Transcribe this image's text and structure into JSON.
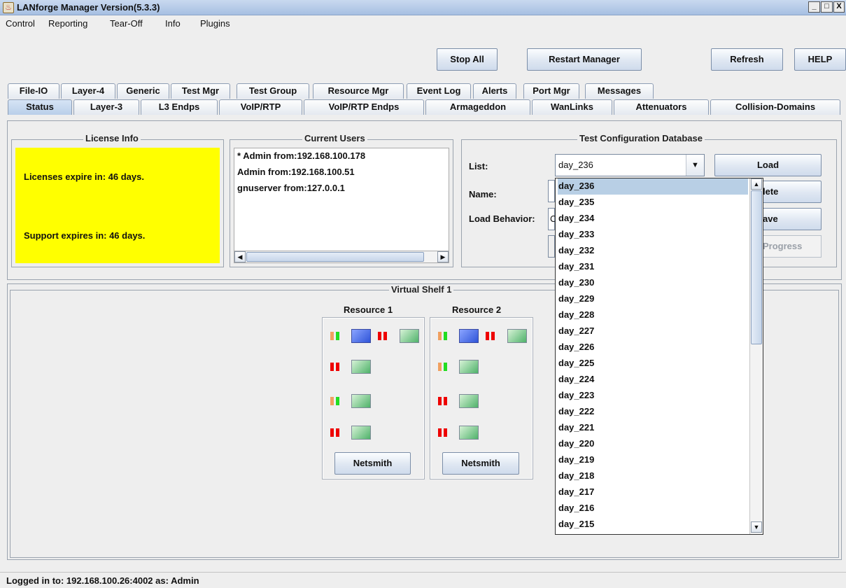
{
  "window": {
    "title": "LANforge Manager   Version(5.3.3)",
    "btn_minimize": "_",
    "btn_maximize": "□",
    "btn_close": "X"
  },
  "menu": [
    "Control",
    "Reporting",
    "Tear-Off",
    "Info",
    "Plugins"
  ],
  "toolbar": {
    "stop_all": "Stop All",
    "restart_manager": "Restart Manager",
    "refresh": "Refresh",
    "help": "HELP"
  },
  "tabs_row1": [
    "File-IO",
    "Layer-4",
    "Generic",
    "Test Mgr",
    "Test Group",
    "Resource Mgr",
    "Event Log",
    "Alerts",
    "Port Mgr",
    "Messages"
  ],
  "tabs_row2": [
    "Status",
    "Layer-3",
    "L3 Endps",
    "VoIP/RTP",
    "VoIP/RTP Endps",
    "Armageddon",
    "WanLinks",
    "Attenuators",
    "Collision-Domains"
  ],
  "license": {
    "title": "License Info",
    "licenses": "Licenses expire in: 46 days.",
    "support": "Support expires in: 46 days."
  },
  "users": {
    "title": "Current Users",
    "list": [
      "* Admin from:192.168.100.178",
      "Admin from:192.168.100.51",
      "gnuserver from:127.0.0.1"
    ]
  },
  "testdb": {
    "title": "Test Configuration Database",
    "list_label": "List:",
    "name_label": "Name:",
    "load_behavior_label": "Load Behavior:",
    "selected": "day_236",
    "load_btn": "Load",
    "delete_btn_visible": "lete",
    "save_btn_visible": "ave",
    "progress_btn_visible": "Progress",
    "load_behavior_visible": "C",
    "options": [
      "day_236",
      "day_235",
      "day_234",
      "day_233",
      "day_232",
      "day_231",
      "day_230",
      "day_229",
      "day_228",
      "day_227",
      "day_226",
      "day_225",
      "day_224",
      "day_223",
      "day_222",
      "day_221",
      "day_220",
      "day_219",
      "day_218",
      "day_217",
      "day_216",
      "day_215"
    ]
  },
  "shelf": {
    "title": "Virtual Shelf 1",
    "resources": [
      {
        "name": "Resource 1",
        "button": "Netsmith"
      },
      {
        "name": "Resource 2",
        "button": "Netsmith"
      }
    ]
  },
  "status": "Logged in to:  192.168.100.26:4002  as:  Admin"
}
